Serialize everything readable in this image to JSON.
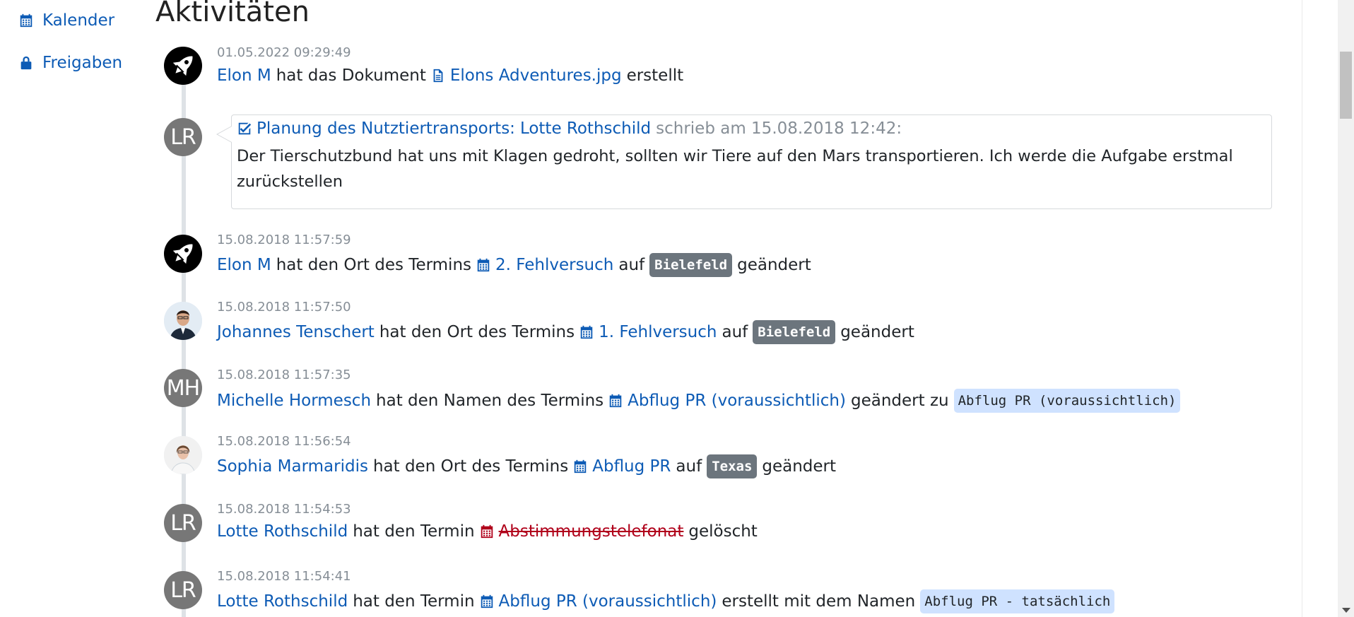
{
  "sidebar": {
    "items": [
      {
        "label": "Kalender",
        "icon": "calendar-icon"
      },
      {
        "label": "Freigaben",
        "icon": "lock-icon"
      }
    ]
  },
  "page": {
    "title": "Aktivitäten"
  },
  "colors": {
    "link": "#0d5bb5",
    "deleted": "#b0001a",
    "badge_dark": "#6c757d",
    "code_chip": "#cfe2ff"
  },
  "entries": [
    {
      "timestamp": "01.05.2022 09:29:49",
      "user": "Elon M",
      "text1": "hat das Dokument",
      "object": "Elons Adventures.jpg",
      "text2": "erstellt"
    },
    {
      "comment": {
        "user_initials": "LR",
        "task": "Planung des Nutztiertransports:",
        "author": "Lotte Rothschild",
        "meta": "schrieb am 15.08.2018 12:42:",
        "body": "Der Tierschutzbund hat uns mit Klagen gedroht, sollten wir Tiere auf den Mars transportieren. Ich werde die Aufgabe erstmal zurückstellen"
      }
    },
    {
      "timestamp": "15.08.2018 11:57:59",
      "user": "Elon M",
      "text1": "hat den Ort des Termins",
      "object": "2. Fehlversuch",
      "text2": "auf",
      "badge": "Bielefeld",
      "text3": "geändert"
    },
    {
      "timestamp": "15.08.2018 11:57:50",
      "user": "Johannes Tenschert",
      "text1": "hat den Ort des Termins",
      "object": "1. Fehlversuch",
      "text2": "auf",
      "badge": "Bielefeld",
      "text3": "geändert"
    },
    {
      "timestamp": "15.08.2018 11:57:35",
      "user_initials": "MH",
      "user": "Michelle Hormesch",
      "text1": "hat den Namen des Termins",
      "object": "Abflug PR (voraussichtlich)",
      "text2": "geändert zu",
      "code": "Abflug PR (voraussichtlich)"
    },
    {
      "timestamp": "15.08.2018 11:56:54",
      "user": "Sophia Marmaridis",
      "text1": "hat den Ort des Termins",
      "object": "Abflug PR",
      "text2": "auf",
      "badge": "Texas",
      "text3": "geändert"
    },
    {
      "timestamp": "15.08.2018 11:54:53",
      "user_initials": "LR",
      "user": "Lotte Rothschild",
      "text1": "hat den Termin",
      "object": "Abstimmungstelefonat",
      "text2": "gelöscht"
    },
    {
      "timestamp": "15.08.2018 11:54:41",
      "user_initials": "LR",
      "user": "Lotte Rothschild",
      "text1": "hat den Termin",
      "object": "Abflug PR (voraussichtlich)",
      "text2": "erstellt mit dem Namen",
      "code": "Abflug PR - tatsächlich"
    }
  ]
}
